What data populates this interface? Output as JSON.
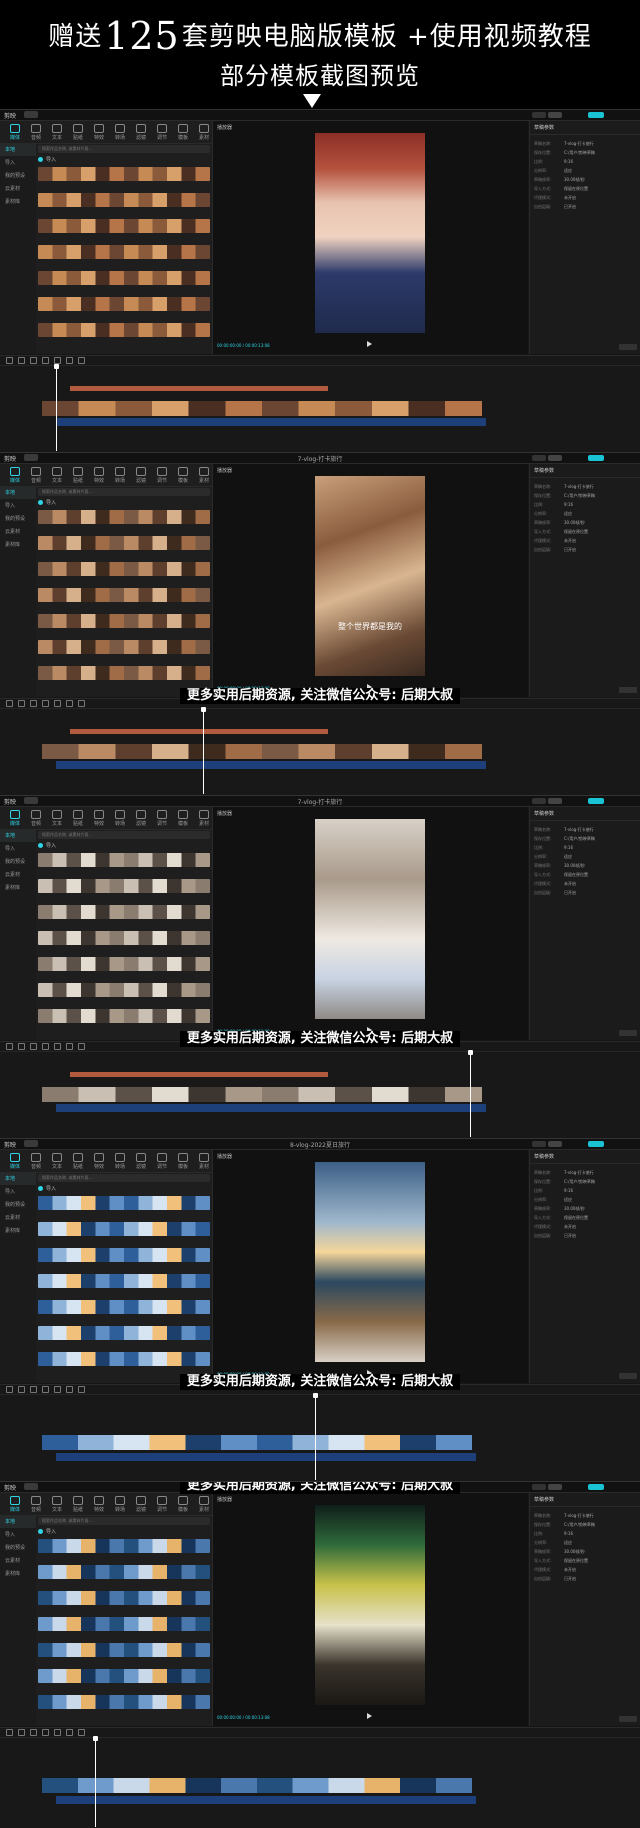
{
  "header": {
    "line1_prefix": "赠送",
    "line1_number": "125",
    "line1_suffix": "套剪映电脑版模板 +使用视频教程",
    "line2": "部分模板截图预览"
  },
  "watermark": "更多实用后期资源, 关注微信公众号: 后期大叔",
  "app": {
    "logo": "剪映",
    "menu": "菜单",
    "tools": [
      "媒体",
      "音频",
      "文本",
      "贴纸",
      "特效",
      "转场",
      "滤镜",
      "调节",
      "模板",
      "素材"
    ],
    "sidebar": [
      "本地",
      "导入",
      "我的预设",
      "云素材",
      "素材库"
    ],
    "import_label": "导入",
    "search_placeholder": "搜索作品名称, 或素材片段...",
    "preview_label": "播放器",
    "props_header": "草稿参数",
    "export_button": "导出",
    "modify_button": "修改",
    "timecode_start": "00:00:00:00",
    "timecode_end": "00:00:13:08",
    "props": [
      {
        "k": "草稿名称:",
        "v": "7-vlog-打卡旅行"
      },
      {
        "k": "保存位置:",
        "v": "C:/用户/剪映草稿"
      },
      {
        "k": "比例:",
        "v": "9:16"
      },
      {
        "k": "分辨率:",
        "v": "适应"
      },
      {
        "k": "草稿帧率:",
        "v": "30.00帧/秒"
      },
      {
        "k": "导入方式:",
        "v": "保留在原位置"
      },
      {
        "k": "代理模式:",
        "v": "未开启"
      },
      {
        "k": "自由层级:",
        "v": "已开启"
      }
    ]
  },
  "screenshots": [
    {
      "title": "",
      "tint": "warm-face"
    },
    {
      "title": "7-vlog-打卡旅行",
      "tint": "hand-warm",
      "subtitle": "整个世界都是我的"
    },
    {
      "title": "7-vlog-打卡旅行",
      "tint": "pale-girl"
    },
    {
      "title": "8-vlog-2022夏日旅行",
      "tint": "sunset-sea"
    },
    {
      "title": "",
      "tint": "night-car"
    }
  ]
}
